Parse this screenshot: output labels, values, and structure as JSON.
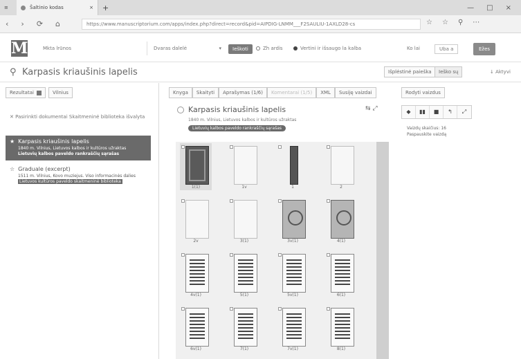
{
  "browser": {
    "tab_title": "Šaltinio kodas",
    "close_tab": "×",
    "new_tab": "+",
    "url": "https://www.manuscriptorium.com/apps/index.php?direct=record&pid=AIPDIG-LNMM___F2SAULIU-1AXLD28-cs",
    "controls": [
      "—",
      "□",
      "×"
    ],
    "nav": [
      "‹",
      "›",
      "⟳",
      "⌂"
    ],
    "url_icons": [
      "☆",
      "☆",
      "⚲",
      "⋯"
    ]
  },
  "header": {
    "logo": "M",
    "brand": "Mkta lrūnos",
    "dropdown": "Dvaras dalelė",
    "search_btn": "Ieškoti",
    "toggle1": "Zh ardis",
    "toggle2": "Vertini ir išsaugo la kalba",
    "right_links": [
      "Ko lai",
      "Uba a",
      "Ežes"
    ]
  },
  "search": {
    "query": "Karpasis kriaušinis lapelis",
    "btn1": "Išplėstinė paieška",
    "btn2": "Ieško sų",
    "btn3": "↓ Aktyvi"
  },
  "left": {
    "tabs": [
      "Rezultatai",
      "Vilnius"
    ],
    "filter_text": "Pasirinkti dokumentai Skaitmeninė biblioteka išvalyta",
    "results": [
      {
        "title": "Karpasis kriaušinis lapelis",
        "meta": "1840 m. Vilnius, Lietuvos kalbos ir kultūros užraktas",
        "tag": "Lietuvių kalbos paveldo rankraščių sąrašas"
      },
      {
        "title": "Graduale (excerpt)",
        "meta": "1511 m. Vilnius, Kovo muziejus. Viso informacinės dalies",
        "tag": "Lietuvos kultūros paveldo skaitmeninė biblioteka"
      }
    ]
  },
  "middle": {
    "tabs": [
      "Knyga",
      "Skaityti",
      "Aprašymas (1/6)",
      "Komentarai (1/5)",
      "XML",
      "Susiję vaizdai"
    ],
    "doc_title": "Karpasis kriaušinis lapelis",
    "doc_meta": "1840 m. Vilnius, Lietuvos kalbos ir kultūros užraktas",
    "doc_tag": "Lietuvių kalbos paveldo rankraščių sąrašas",
    "tools": "⇆ ⤢",
    "thumbs": [
      {
        "style": "dark",
        "label": "1(1)"
      },
      {
        "style": "blank",
        "label": "1v"
      },
      {
        "style": "spine",
        "label": "1"
      },
      {
        "style": "blank",
        "label": "2"
      },
      {
        "style": "blank",
        "label": "2v"
      },
      {
        "style": "blank",
        "label": "3(1)"
      },
      {
        "style": "ornate",
        "label": "3v(1)"
      },
      {
        "style": "ornate",
        "label": "4(1)"
      },
      {
        "style": "text",
        "label": "4v(1)"
      },
      {
        "style": "text",
        "label": "5(1)"
      },
      {
        "style": "text",
        "label": "5v(1)"
      },
      {
        "style": "text",
        "label": "6(1)"
      },
      {
        "style": "text",
        "label": "6v(1)"
      },
      {
        "style": "text",
        "label": "7(1)"
      },
      {
        "style": "text",
        "label": "7v(1)"
      },
      {
        "style": "text",
        "label": "8(1)"
      }
    ]
  },
  "right": {
    "panel_btn": "Rodyti vaizdus",
    "toolbar": [
      "◆",
      "▮▮",
      "■",
      "↰",
      "⤢"
    ],
    "info_lines": [
      "Vaizdų skaičius: 16",
      "Paspauskite vaizdą"
    ]
  }
}
